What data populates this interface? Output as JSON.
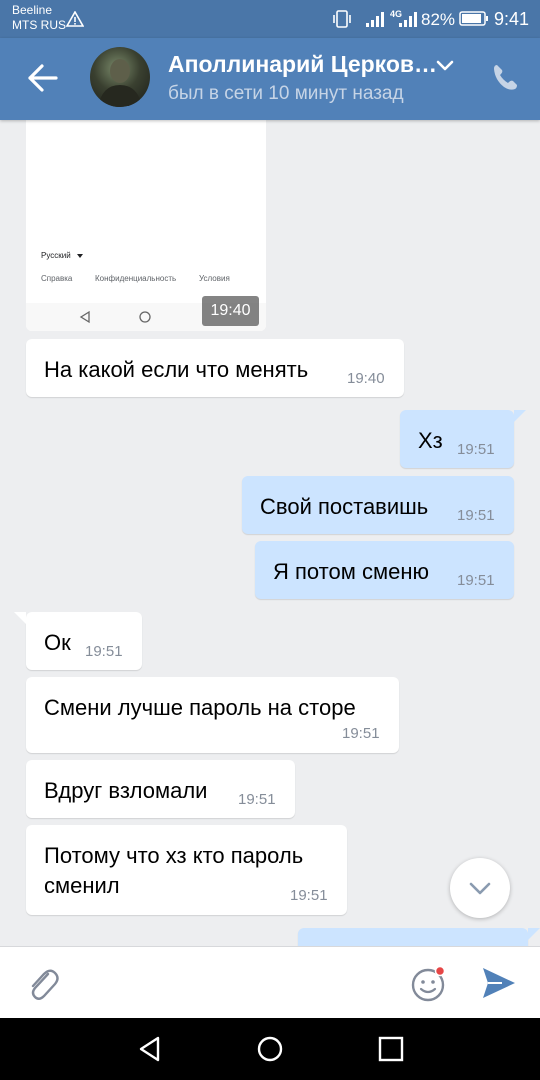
{
  "status_bar": {
    "carrier_line1": "Beeline",
    "carrier_line2": "MTS RUS",
    "network": "4G",
    "battery": "82%",
    "time": "9:41"
  },
  "header": {
    "contact_name": "Аполлинарий Церков…",
    "status": "был в сети 10 минут назад"
  },
  "screenshot_image": {
    "language": "Русский",
    "links": [
      "Справка",
      "Конфиденциальность",
      "Условия"
    ],
    "time": "19:40"
  },
  "messages": [
    {
      "dir": "in",
      "text": "На какой если что менять",
      "time": "19:40"
    },
    {
      "dir": "out",
      "text": "Хз",
      "time": "19:51"
    },
    {
      "dir": "out",
      "text": "Свой поставишь",
      "time": "19:51"
    },
    {
      "dir": "out",
      "text": "Я потом сменю",
      "time": "19:51"
    },
    {
      "dir": "in",
      "text": "Ок",
      "time": "19:51"
    },
    {
      "dir": "in",
      "text": "Смени лучше пароль на сторе",
      "time": "19:51"
    },
    {
      "dir": "in",
      "text": "Вдруг взломали",
      "time": "19:51"
    },
    {
      "dir": "in",
      "text_line1": "Потому что хз кто пароль",
      "text_line2": "сменил",
      "time": "19:51"
    }
  ],
  "colors": {
    "header": "#5181b8",
    "status_bar": "#4a76a8",
    "incoming_bubble": "#ffffff",
    "outgoing_bubble": "#cce4ff",
    "chat_background": "#edeef0",
    "accent": "#5181b8"
  },
  "icons": {
    "back": "arrow-left-icon",
    "chevron": "chevron-down-icon",
    "call": "phone-icon",
    "attach": "paperclip-icon",
    "emoji": "smile-icon",
    "send": "send-icon",
    "scroll_down": "chevron-down-icon"
  }
}
